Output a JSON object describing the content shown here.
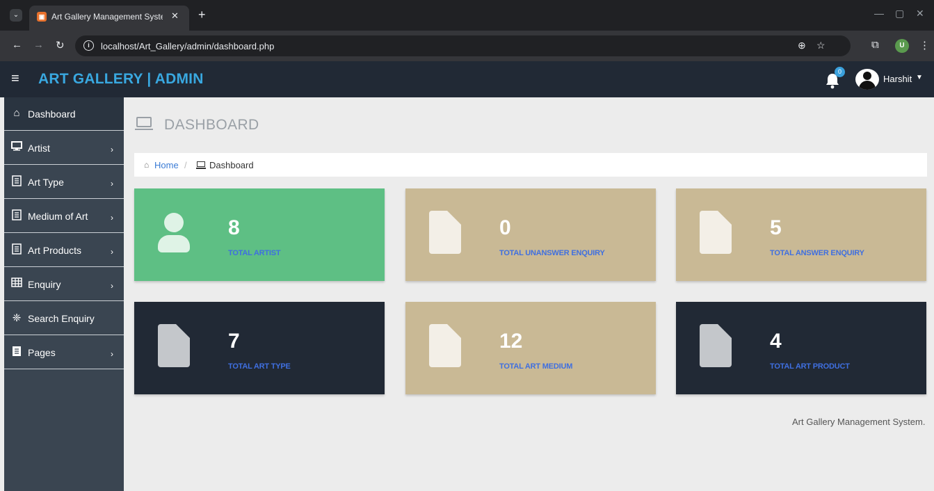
{
  "browser": {
    "tab_title": "Art Gallery Management Systen",
    "url": "localhost/Art_Gallery/admin/dashboard.php",
    "profile_initial": "U"
  },
  "header": {
    "brand": "ART GALLERY | ADMIN",
    "notification_count": "0",
    "user_name": "Harshit"
  },
  "sidebar": {
    "items": [
      {
        "label": "Dashboard",
        "icon": "home-icon"
      },
      {
        "label": "Artist",
        "icon": "desktop-icon"
      },
      {
        "label": "Art Type",
        "icon": "document-icon"
      },
      {
        "label": "Medium of Art",
        "icon": "document-icon"
      },
      {
        "label": "Art Products",
        "icon": "document-icon"
      },
      {
        "label": "Enquiry",
        "icon": "table-icon"
      },
      {
        "label": "Search Enquiry",
        "icon": "search-gear-icon"
      },
      {
        "label": "Pages",
        "icon": "file-icon"
      }
    ]
  },
  "main": {
    "page_title": "DASHBOARD",
    "breadcrumb": {
      "home": "Home",
      "current": "Dashboard"
    },
    "cards": [
      {
        "value": "8",
        "label": "TOTAL ARTIST",
        "color": "#5ebf84",
        "icon": "user-icon"
      },
      {
        "value": "0",
        "label": "TOTAL UNANSWER ENQUIRY",
        "color": "#c9b995",
        "icon": "document-icon"
      },
      {
        "value": "5",
        "label": "TOTAL ANSWER ENQUIRY",
        "color": "#c9b995",
        "icon": "document-icon"
      },
      {
        "value": "7",
        "label": "TOTAL ART TYPE",
        "color": "#212935",
        "icon": "document-icon"
      },
      {
        "value": "12",
        "label": "TOTAL ART MEDIUM",
        "color": "#c9b995",
        "icon": "document-icon"
      },
      {
        "value": "4",
        "label": "TOTAL ART PRODUCT",
        "color": "#212935",
        "icon": "document-icon"
      }
    ]
  },
  "footer": {
    "text": "Art Gallery Management System."
  }
}
